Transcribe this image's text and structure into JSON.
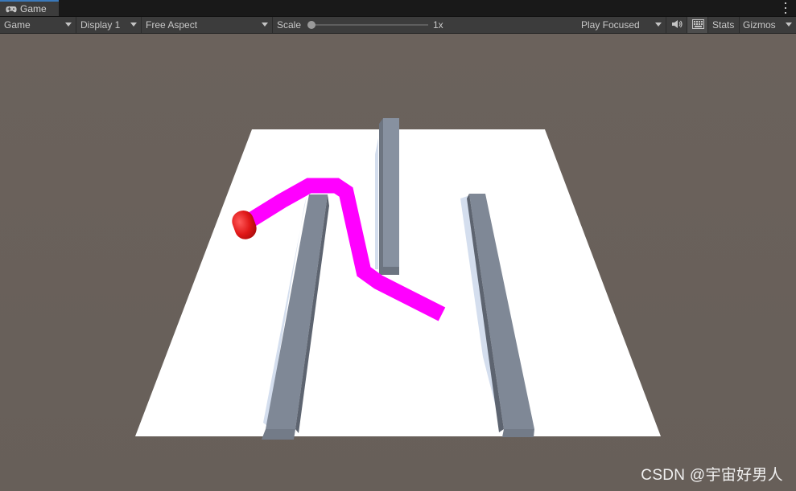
{
  "tab": {
    "label": "Game",
    "icon": "gamepad-icon"
  },
  "toolbar": {
    "view_select": "Game",
    "display_select": "Display 1",
    "aspect_select": "Free Aspect",
    "scale_label": "Scale",
    "scale_value": "1x",
    "play_mode_select": "Play Focused",
    "stats_label": "Stats",
    "gizmos_label": "Gizmos"
  },
  "watermark": "CSDN @宇宙好男人",
  "colors": {
    "background": "#6a615b",
    "plane": "#ffffff",
    "wall": "#7f8896",
    "trail": "#ff00ff",
    "player": "#e32020",
    "accent": "#3a79bb"
  }
}
